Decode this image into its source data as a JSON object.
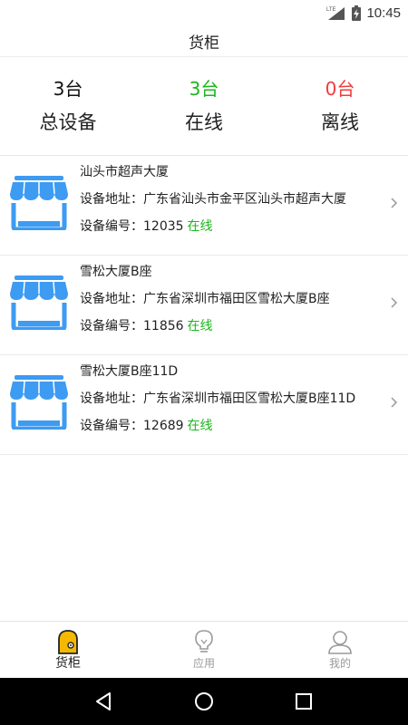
{
  "status_bar": {
    "network": "LTE",
    "time": "10:45"
  },
  "header": {
    "title": "货柜"
  },
  "summary": {
    "total": {
      "count": "3台",
      "label": "总设备"
    },
    "online": {
      "count": "3台",
      "label": "在线"
    },
    "offline": {
      "count": "0台",
      "label": "离线"
    }
  },
  "devices": [
    {
      "name": "汕头市超声大厦",
      "address": "设备地址：广东省汕头市金平区汕头市超声大厦",
      "id_label": "设备编号：12035",
      "status": "在线"
    },
    {
      "name": "雪松大厦B座",
      "address": "设备地址：广东省深圳市福田区雪松大厦B座",
      "id_label": "设备编号：11856",
      "status": "在线"
    },
    {
      "name": "雪松大厦B座11D",
      "address": "设备地址：广东省深圳市福田区雪松大厦B座11D",
      "id_label": "设备编号：12689",
      "status": "在线"
    }
  ],
  "tabs": [
    {
      "label": "货柜",
      "icon": "locker-icon",
      "active": true
    },
    {
      "label": "应用",
      "icon": "lightbulb-icon",
      "active": false
    },
    {
      "label": "我的",
      "icon": "user-icon",
      "active": false
    }
  ],
  "colors": {
    "online": "#1cb51c",
    "offline": "#f23b3b",
    "store_icon": "#3d9bf2",
    "active_tab": "#f5b800"
  }
}
